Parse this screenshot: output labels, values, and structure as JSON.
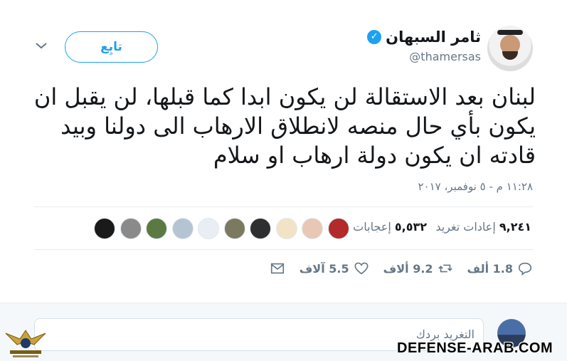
{
  "user": {
    "display_name": "ثامر السبهان",
    "handle": "@thamersas",
    "verified_icon": "verified-badge-icon"
  },
  "follow_button": "تابِع",
  "tweet_text": "لبنان بعد الاستقالة لن يكون ابدا كما قبلها، لن يقبل ان يكون بأي حال منصه لانطلاق الارهاب الى دولنا وبيد قادته ان يكون دولة ارهاب او سلام",
  "timestamp": "١١:٢٨ م - ٥ نوفمبر، ٢٠١٧",
  "stats": {
    "retweets_count": "٩,٢٤١",
    "retweets_label": "إعادات تغريد",
    "likes_count": "٥,٥٣٢",
    "likes_label": "إعجابات"
  },
  "likers": [
    {
      "color": "#b22a2a"
    },
    {
      "color": "#e9c7b5"
    },
    {
      "color": "#f3e3c6"
    },
    {
      "color": "#2f2f2f"
    },
    {
      "color": "#7c7a5e"
    },
    {
      "color": "#e8eef3"
    },
    {
      "color": "#b4c4d3"
    },
    {
      "color": "#5a7a42"
    },
    {
      "color": "#8a8a8a"
    },
    {
      "color": "#1a1a1a"
    }
  ],
  "actions": {
    "reply": {
      "icon": "reply-icon",
      "count": "1.8 ألف"
    },
    "retweet": {
      "icon": "retweet-icon",
      "count": "9.2 ألاف"
    },
    "like": {
      "icon": "heart-icon",
      "count": "5.5 آلاف"
    },
    "message": {
      "icon": "envelope-icon"
    }
  },
  "reply_box": {
    "placeholder": "التغريد بردك"
  },
  "watermark": {
    "text": "DEFENSE-ARAB.COM",
    "logo": "arab-defense-forum-logo"
  }
}
